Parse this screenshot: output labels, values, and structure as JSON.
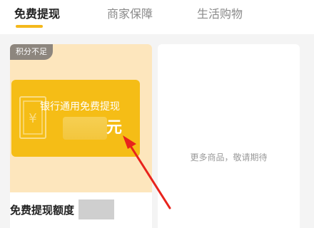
{
  "tabs": [
    {
      "label": "免费提现",
      "active": true
    },
    {
      "label": "商家保障",
      "active": false
    },
    {
      "label": "生活购物",
      "active": false
    }
  ],
  "colors": {
    "accent": "#f4b81c",
    "voucher": "#f5bd16",
    "promo_background": "#fde6bd",
    "annotation_arrow": "#e8231c"
  },
  "product": {
    "badge": "积分不足",
    "voucher_title": "银行通用免费提现",
    "voucher_unit": "元",
    "voucher_icon": "yuan-document-icon",
    "name": "免费提现额度"
  },
  "placeholder_card": {
    "text": "更多商品，敬请期待"
  }
}
